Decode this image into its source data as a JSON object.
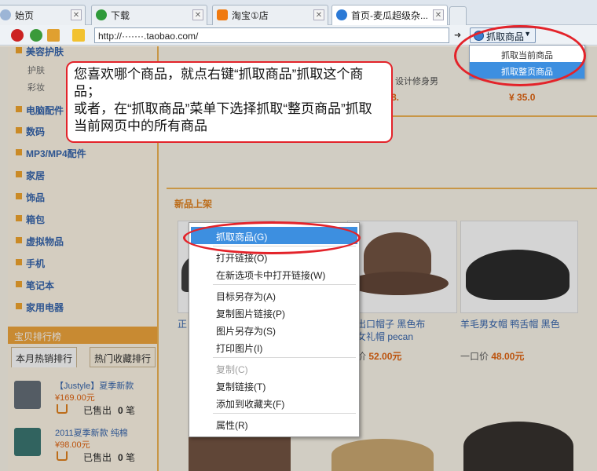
{
  "tabs": [
    {
      "label": "始页",
      "icon": "page-icon",
      "active": false
    },
    {
      "label": "下载",
      "icon": "green-check-icon",
      "active": false
    },
    {
      "label": "淘宝①店",
      "icon": "taobao-icon",
      "active": false
    },
    {
      "label": "首页-麦瓜超级杂...",
      "icon": "ie-icon",
      "active": true
    }
  ],
  "address": {
    "url": "http://·······.taobao.com/"
  },
  "grab_button": {
    "label": "抓取商品",
    "menu": [
      "抓取当前商品",
      "抓取整页商品"
    ]
  },
  "sidebar": {
    "categories": [
      "美容护肤",
      "电脑配件",
      "数码",
      "MP3/MP4配件",
      "家居",
      "饰品",
      "箱包",
      "虚拟物品",
      "手机",
      "笔记本",
      "家用电器"
    ],
    "subcategories": [
      "护肤",
      "彩妆"
    ],
    "ranking": {
      "title": "宝贝排行榜",
      "tabs": [
        "本月热销排行",
        "热门收藏排行"
      ],
      "items": [
        {
          "title": "【Justyle】夏季新款",
          "price": "169.00元",
          "sold_label": "已售出",
          "sold": "0",
          "unit": "笔"
        },
        {
          "title": "2011夏季新款 纯棉",
          "price": "98.00元",
          "sold_label": "已售出",
          "sold": "0",
          "unit": "笔"
        }
      ]
    }
  },
  "top_strip": {
    "item_title": "设计修身男",
    "price_left": "8.",
    "price_right": "¥ 35.0"
  },
  "section": {
    "title": "新品上架"
  },
  "products": [
    {
      "title": "正",
      "price": ""
    },
    {
      "title": "供出口帽子 黑色布\n质女礼帽 pecan",
      "price_label": "口价",
      "price": "52.00元"
    },
    {
      "title": "羊毛男女帽 鸭舌帽 黑色",
      "price_label": "一口价",
      "price": "48.00元"
    }
  ],
  "context_menu": {
    "groups": [
      [
        {
          "label": "抓取商品(G)",
          "highlight": true
        }
      ],
      [
        {
          "label": "打开链接(O)"
        },
        {
          "label": "在新选项卡中打开链接(W)"
        }
      ],
      [
        {
          "label": "目标另存为(A)"
        },
        {
          "label": "复制图片链接(P)"
        },
        {
          "label": "图片另存为(S)"
        },
        {
          "label": "打印图片(I)"
        }
      ],
      [
        {
          "label": "复制(C)",
          "disabled": true
        },
        {
          "label": "复制链接(T)"
        },
        {
          "label": "添加到收藏夹(F)"
        }
      ],
      [
        {
          "label": "属性(R)"
        }
      ]
    ]
  },
  "callout": {
    "line1": "您喜欢哪个商品，就点右键“抓取商品”抓取这个商品；",
    "line2": "或者，在“抓取商品”菜单下选择抓取“整页商品”抓取当前网页中的所有商品"
  },
  "colors": {
    "accent": "#e3232a",
    "highlight": "#3d8fe0",
    "price": "#e05a00",
    "link": "#2a5ca8",
    "category_bullet": "#f2a020"
  }
}
